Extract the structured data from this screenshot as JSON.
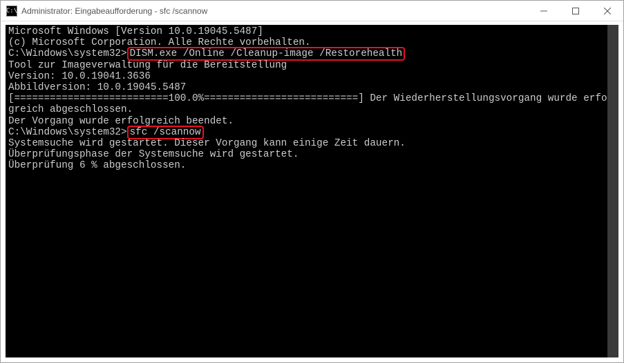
{
  "window": {
    "title": "Administrator: Eingabeaufforderung - sfc  /scannow",
    "icon_glyph": "C:\\"
  },
  "console": {
    "line1": "Microsoft Windows [Version 10.0.19045.5487]",
    "line2": "(c) Microsoft Corporation. Alle Rechte vorbehalten.",
    "blank1": "",
    "prompt1": "C:\\Windows\\system32>",
    "cmd1": "DISM.exe /Online /Cleanup-image /Restorehealth",
    "blank2": "",
    "tool1": "Tool zur Imageverwaltung für die Bereitstellung",
    "tool2": "Version: 10.0.19041.3636",
    "blank3": "",
    "abbild": "Abbildversion: 10.0.19045.5487",
    "blank4": "",
    "progress": "[==========================100.0%==========================] Der Wiederherstellungsvorgang wurde erfolgreich abgeschlossen.",
    "done1": "Der Vorgang wurde erfolgreich beendet.",
    "blank5": "",
    "prompt2": "C:\\Windows\\system32>",
    "cmd2": "sfc /scannow",
    "blank6": "",
    "sys1": "Systemsuche wird gestartet. Dieser Vorgang kann einige Zeit dauern.",
    "blank7": "",
    "phase1": "Überprüfungsphase der Systemsuche wird gestartet.",
    "phase2": "Überprüfung 6 % abgeschlossen."
  }
}
